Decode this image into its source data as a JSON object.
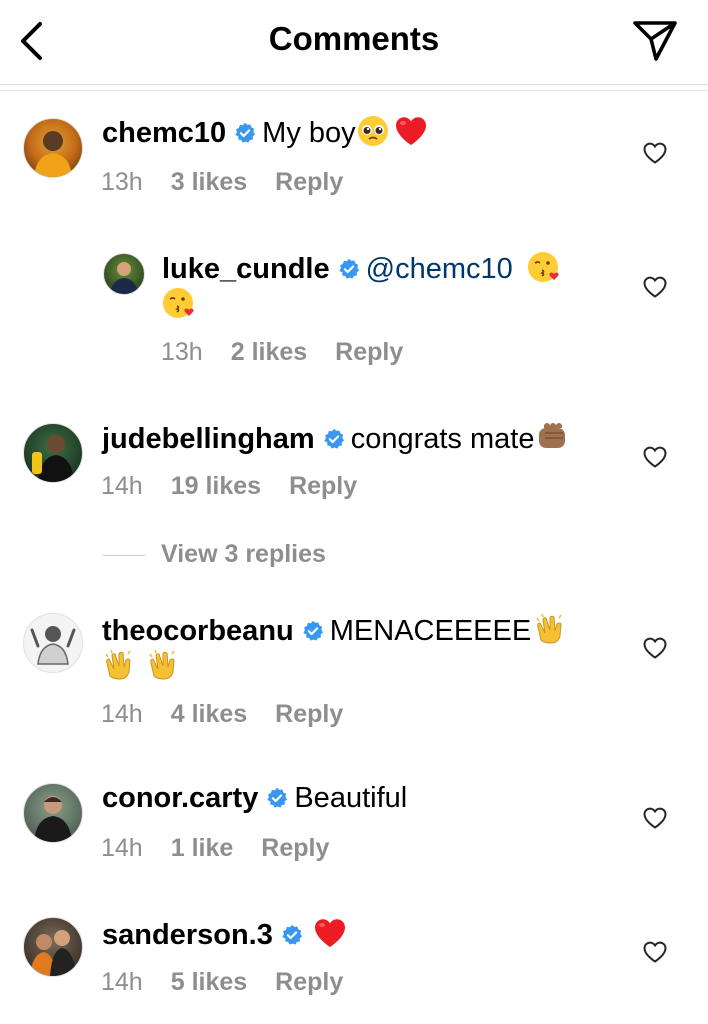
{
  "header": {
    "title": "Comments",
    "back_icon": "chevron-left-icon",
    "send_icon": "paper-plane-icon"
  },
  "comments": [
    {
      "username": "chemc10",
      "verified": true,
      "text": "My boy",
      "emojis": [
        "pleading-face",
        "red-heart"
      ],
      "time": "13h",
      "likes": "3 likes",
      "reply": "Reply"
    },
    {
      "username": "luke_cundle",
      "verified": true,
      "mention": "@chemc10",
      "emojis": [
        "kissing-face",
        "kissing-face"
      ],
      "time": "13h",
      "likes": "2 likes",
      "reply": "Reply"
    },
    {
      "username": "judebellingham",
      "verified": true,
      "text": "congrats mate",
      "emojis": [
        "fist-bump"
      ],
      "time": "14h",
      "likes": "19 likes",
      "reply": "Reply"
    },
    {
      "username": "theocorbeanu",
      "verified": true,
      "text": "MENACEEEEE",
      "emojis": [
        "clapping-hands",
        "clapping-hands",
        "clapping-hands"
      ],
      "time": "14h",
      "likes": "4 likes",
      "reply": "Reply"
    },
    {
      "username": "conor.carty",
      "verified": true,
      "text": "Beautiful",
      "time": "14h",
      "likes": "1 like",
      "reply": "Reply"
    },
    {
      "username": "sanderson.3",
      "verified": true,
      "emojis": [
        "red-heart"
      ],
      "time": "14h",
      "likes": "5 likes",
      "reply": "Reply"
    }
  ],
  "view_replies": "View 3 replies",
  "colors": {
    "verified_blue": "#3897f0",
    "meta_gray": "#8e8e8e",
    "mention_blue": "#00376b",
    "heart_red": "#ed1c24"
  }
}
